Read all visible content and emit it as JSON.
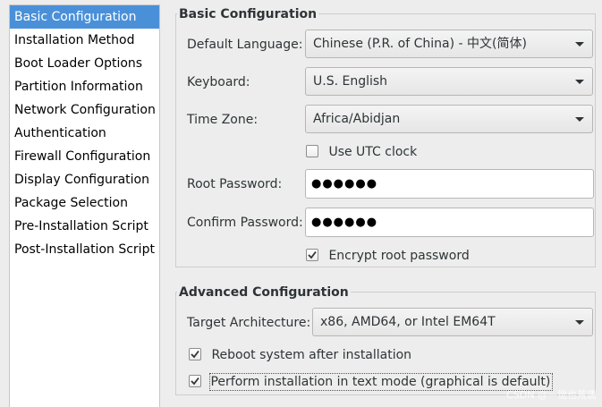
{
  "sidebar": {
    "items": [
      {
        "label": "Basic Configuration",
        "selected": true
      },
      {
        "label": "Installation Method"
      },
      {
        "label": "Boot Loader Options"
      },
      {
        "label": "Partition Information"
      },
      {
        "label": "Network Configuration"
      },
      {
        "label": "Authentication"
      },
      {
        "label": "Firewall Configuration"
      },
      {
        "label": "Display Configuration"
      },
      {
        "label": "Package Selection"
      },
      {
        "label": "Pre-Installation Script"
      },
      {
        "label": "Post-Installation Script"
      }
    ],
    "selected_color": "#4a90d9"
  },
  "basic": {
    "title": "Basic Configuration",
    "default_language_label": "Default Language:",
    "default_language_value": "Chinese (P.R. of China) - 中文(简体)",
    "keyboard_label": "Keyboard:",
    "keyboard_value": "U.S. English",
    "timezone_label": "Time Zone:",
    "timezone_value": "Africa/Abidjan",
    "utc_label": "Use UTC clock",
    "utc_checked": false,
    "root_password_label": "Root Password:",
    "root_password_value": "●●●●●●",
    "confirm_password_label": "Confirm Password:",
    "confirm_password_value": "●●●●●●",
    "encrypt_label": "Encrypt root password",
    "encrypt_checked": true
  },
  "advanced": {
    "title": "Advanced Configuration",
    "target_arch_label": "Target Architecture:",
    "target_arch_value": "x86, AMD64, or Intel EM64T",
    "reboot_label": "Reboot system after installation",
    "reboot_checked": true,
    "textmode_label": "Perform installation in text mode (graphical is default)",
    "textmode_checked": true
  },
  "watermark": "CSDN @一觉也荒唐"
}
